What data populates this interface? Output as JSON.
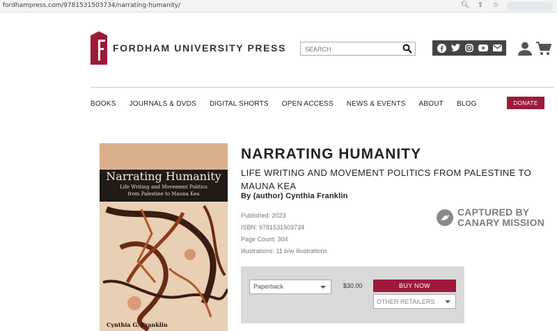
{
  "browser": {
    "url": "fordhampress.com/9781531503734/narrating-humanity/"
  },
  "header": {
    "logo_text": "FORDHAM UNIVERSITY PRESS",
    "search_placeholder": "SEARCH",
    "social_icons": [
      "facebook-icon",
      "twitter-icon",
      "instagram-icon",
      "youtube-icon",
      "email-icon"
    ]
  },
  "nav": {
    "items": [
      "BOOKS",
      "JOURNALS & DVDS",
      "DIGITAL SHORTS",
      "OPEN ACCESS",
      "NEWS & EVENTS",
      "ABOUT",
      "BLOG"
    ],
    "donate_label": "DONATE"
  },
  "book": {
    "cover": {
      "title": "Narrating Humanity",
      "subtitle_line1": "Life Writing and Movement Politics",
      "subtitle_line2": "from Palestine to Mauna Kea",
      "author": "Cynthia G. Franklin"
    },
    "title": "NARRATING HUMANITY",
    "subtitle": "LIFE WRITING AND MOVEMENT POLITICS FROM PALESTINE TO MAUNA KEA",
    "author_line": "By (author) Cynthia Franklin",
    "published": "Published: 2023",
    "isbn": "ISBN: 9781531503734",
    "page_count": "Page Count: 304",
    "illustrations": "Illustrations: 11 b/w illustrations"
  },
  "watermark": {
    "line1": "CAPTURED BY",
    "line2": "CANARY MISSION"
  },
  "purchase": {
    "format": "Paperback",
    "price": "$30.00",
    "buy_label": "BUY NOW",
    "retailers_label": "OTHER RETAILERS"
  },
  "colors": {
    "brand": "#9d1a3a",
    "social_bar": "#444444"
  }
}
